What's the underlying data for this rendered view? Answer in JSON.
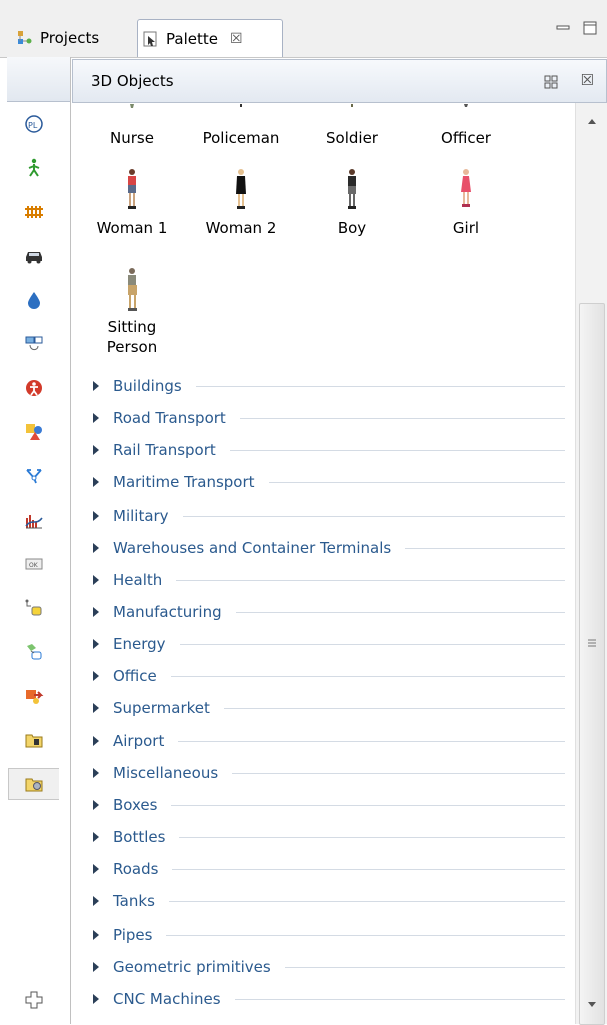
{
  "tabs": [
    {
      "label": "Projects",
      "icon": "projects-icon"
    },
    {
      "label": "Palette",
      "icon": "palette-icon",
      "close": "☒"
    }
  ],
  "panel": {
    "title": "3D Objects",
    "view_icon": "grid-view-icon",
    "close": "☒"
  },
  "objects": [
    {
      "label": "Nurse"
    },
    {
      "label": "Policeman"
    },
    {
      "label": "Soldier"
    },
    {
      "label": "Officer"
    },
    {
      "label": "Woman 1"
    },
    {
      "label": "Woman 2"
    },
    {
      "label": "Boy"
    },
    {
      "label": "Girl"
    },
    {
      "label": "Sitting Person"
    }
  ],
  "categories": [
    "Buildings",
    "Road Transport",
    "Rail Transport",
    "Maritime Transport",
    "Military",
    "Warehouses and Container Terminals",
    "Health",
    "Manufacturing",
    "Energy",
    "Office",
    "Supermarket",
    "Airport",
    "Miscellaneous",
    "Boxes",
    "Bottles",
    "Roads",
    "Tanks",
    "Pipes",
    "Geometric primitives",
    "CNC Machines"
  ],
  "library_icons": [
    "process-modeling-icon",
    "pedestrian-icon",
    "rail-icon",
    "road-traffic-icon",
    "fluid-icon",
    "agent-icon",
    "system-dynamics-icon",
    "presentation-icon",
    "space-markup-icon",
    "analysis-icon",
    "controls-icon",
    "connectivity-icon",
    "statechart-icon",
    "actions-icon",
    "pictures-icon",
    "3d-objects-icon"
  ],
  "add_library_icon": "add-palette-icon"
}
